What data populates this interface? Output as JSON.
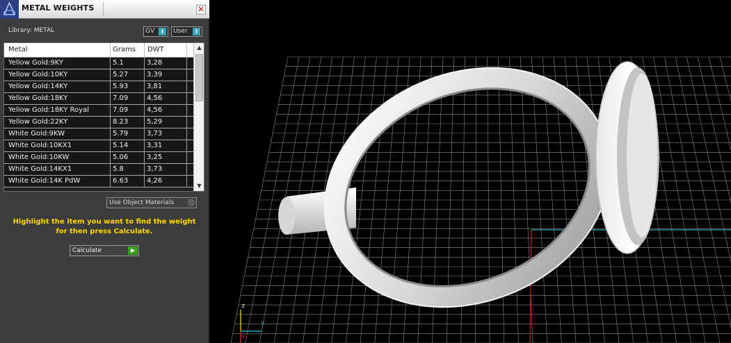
{
  "panel": {
    "title": "METAL WEIGHTS",
    "close_icon": "close-icon",
    "library_label": "Library: METAL",
    "gv_label": "GV",
    "user_label": "User",
    "columns": [
      "Metal",
      "Grams",
      "DWT"
    ],
    "rows": [
      {
        "metal": "Yellow Gold:9KY",
        "grams": "5.1",
        "dwt": "3,28"
      },
      {
        "metal": "Yellow Gold:10KY",
        "grams": "5.27",
        "dwt": "3,39"
      },
      {
        "metal": "Yellow Gold:14KY",
        "grams": "5.93",
        "dwt": "3,81"
      },
      {
        "metal": "Yellow Gold:18KY",
        "grams": "7.09",
        "dwt": "4,56"
      },
      {
        "metal": "Yellow Gold:18KY Royal",
        "grams": "7.09",
        "dwt": "4,56"
      },
      {
        "metal": "Yellow Gold:22KY",
        "grams": "8.23",
        "dwt": "5,29"
      },
      {
        "metal": "White Gold:9KW",
        "grams": "5.79",
        "dwt": "3,73"
      },
      {
        "metal": "White Gold:10KX1",
        "grams": "5.14",
        "dwt": "3,31"
      },
      {
        "metal": "White Gold:10KW",
        "grams": "5.06",
        "dwt": "3,25"
      },
      {
        "metal": "White Gold:14KX1",
        "grams": "5.8",
        "dwt": "3,73"
      },
      {
        "metal": "White Gold:14K PdW",
        "grams": "6.63",
        "dwt": "4,26"
      }
    ],
    "use_object_materials": "Use Object Materials",
    "hint": "Highlight the item you want to find the weight for then press Calculate.",
    "calculate_label": "Calculate"
  },
  "viewport": {
    "axis_z": "z",
    "axis_y": "y",
    "axis_x": "x"
  },
  "colors": {
    "hint": "#ffd800",
    "axis_cyan": "#2ea8c4",
    "axis_red": "#d02a2a",
    "panel_bg": "#3c3c3c"
  }
}
